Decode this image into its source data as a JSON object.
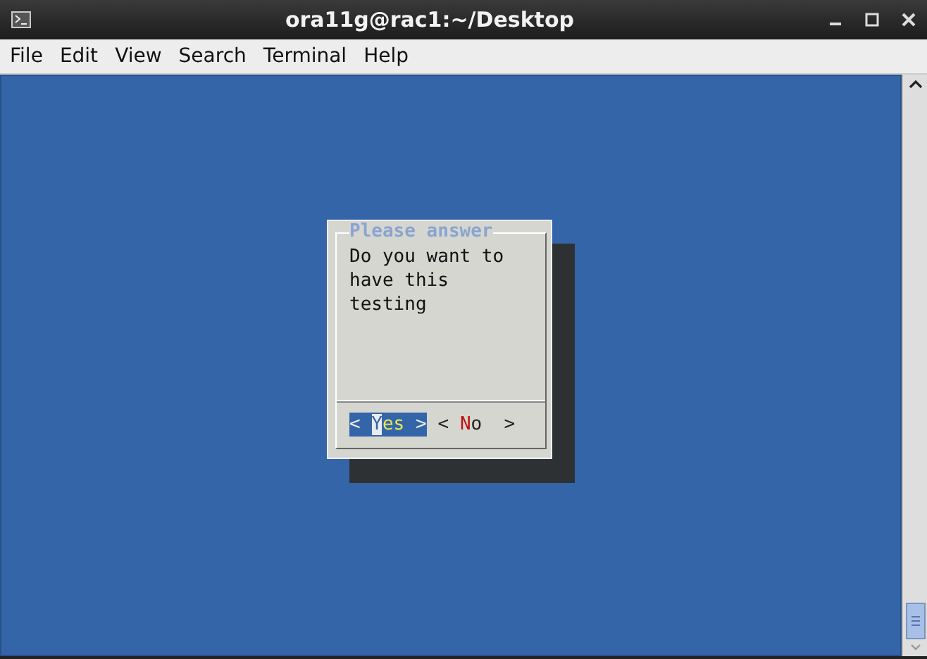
{
  "window": {
    "title": "ora11g@rac1:~/Desktop"
  },
  "menu": [
    "File",
    "Edit",
    "View",
    "Search",
    "Terminal",
    "Help"
  ],
  "dialog": {
    "title": "Please answer",
    "message": "Do you want to\nhave this\ntesting",
    "buttons": [
      {
        "open": "<",
        "hotkey": "Y",
        "rest": "es",
        "close": ">",
        "selected": true
      },
      {
        "open": "<",
        "hotkey": "N",
        "rest": "o",
        "close": ">",
        "selected": false
      }
    ]
  }
}
